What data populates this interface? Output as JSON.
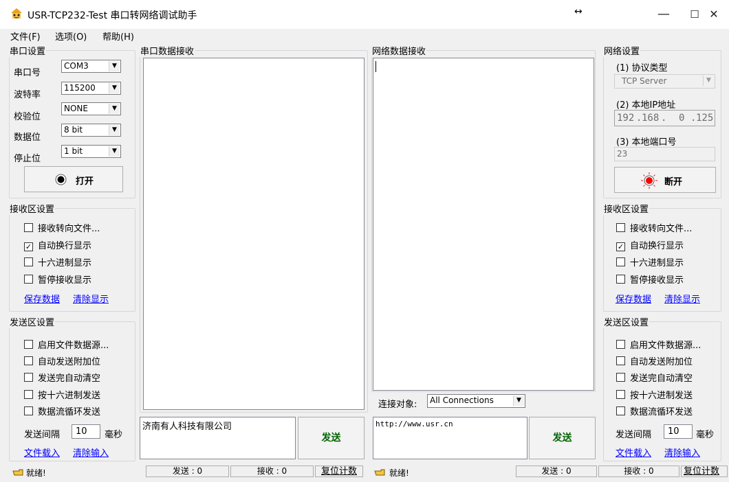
{
  "window": {
    "title": "USR-TCP232-Test 串口转网络调试助手",
    "resize_glyph": "↔",
    "minimize": "—",
    "maximize": "☐",
    "close": "✕"
  },
  "menu": [
    "文件(F)",
    "选项(O)",
    "帮助(H)"
  ],
  "serial_settings": {
    "legend": "串口设置",
    "port_label": "串口号",
    "port_value": "COM3",
    "baud_label": "波特率",
    "baud_value": "115200",
    "parity_label": "校验位",
    "parity_value": "NONE",
    "data_bits_label": "数据位",
    "data_bits_value": "8 bit",
    "stop_bits_label": "停止位",
    "stop_bits_value": "1 bit",
    "open_button": "打开"
  },
  "left_recv": {
    "legend": "接收区设置",
    "opt1": "接收转向文件...",
    "opt2": "自动换行显示",
    "opt3": "十六进制显示",
    "opt4": "暂停接收显示",
    "save_link": "保存数据",
    "clear_link": "清除显示"
  },
  "left_send": {
    "legend": "发送区设置",
    "opt1": "启用文件数据源...",
    "opt2": "自动发送附加位",
    "opt3": "发送完自动清空",
    "opt4": "按十六进制发送",
    "opt5": "数据流循环发送",
    "interval_label": "发送间隔",
    "interval_value": "10",
    "interval_unit": "毫秒",
    "load_link": "文件载入",
    "clear_link": "清除输入"
  },
  "serial_recv": {
    "legend": "串口数据接收",
    "content": ""
  },
  "serial_send": {
    "content": "济南有人科技有限公司",
    "button": "发送"
  },
  "net_recv": {
    "legend": "网络数据接收",
    "content": ""
  },
  "net_target": {
    "label": "连接对象:",
    "value": "All Connections"
  },
  "net_send": {
    "content": "http://www.usr.cn",
    "button": "发送"
  },
  "net_settings": {
    "legend": "网络设置",
    "protocol_label": "(1) 协议类型",
    "protocol_value": "TCP Server",
    "ip_label": "(2) 本地IP地址",
    "ip_1": "192",
    "ip_2": "168",
    "ip_3": "0",
    "ip_4": "125",
    "port_label": "(3) 本地端口号",
    "port_value": "23",
    "close_button": "断开"
  },
  "right_recv": {
    "legend": "接收区设置",
    "opt1": "接收转向文件...",
    "opt2": "自动换行显示",
    "opt3": "十六进制显示",
    "opt4": "暂停接收显示",
    "save_link": "保存数据",
    "clear_link": "清除显示"
  },
  "right_send": {
    "legend": "发送区设置",
    "opt1": "启用文件数据源...",
    "opt2": "自动发送附加位",
    "opt3": "发送完自动清空",
    "opt4": "按十六进制发送",
    "opt5": "数据流循环发送",
    "interval_label": "发送间隔",
    "interval_value": "10",
    "interval_unit": "毫秒",
    "load_link": "文件载入",
    "clear_link": "清除输入"
  },
  "status_left": {
    "ready": "就绪!",
    "sent": "发送 : 0",
    "received": "接收 : 0",
    "reset": "复位计数"
  },
  "status_right": {
    "ready": "就绪!",
    "sent": "发送 : 0",
    "received": "接收 : 0",
    "reset": "复位计数"
  },
  "checked": "✓",
  "colors": {
    "link": "#0000ff",
    "led_on": "#ff0000",
    "led_off": "#000000"
  }
}
